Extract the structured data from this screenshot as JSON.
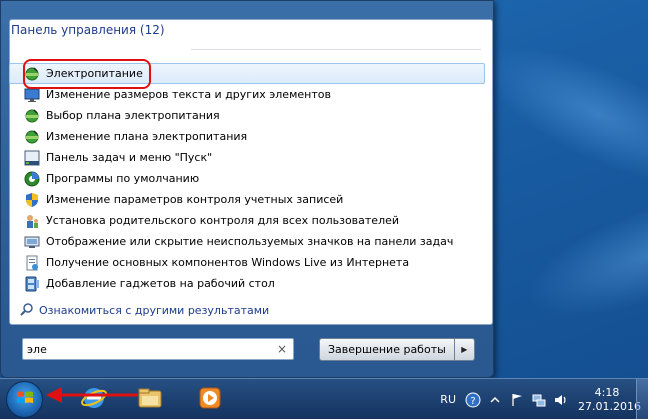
{
  "start_menu": {
    "section_header": "Панель управления (12)",
    "results": [
      {
        "label": "Электропитание",
        "icon": "power-options-icon",
        "selected": true
      },
      {
        "label": "Изменение размеров текста и других элементов",
        "icon": "display-icon"
      },
      {
        "label": "Выбор плана электропитания",
        "icon": "power-options-icon"
      },
      {
        "label": "Изменение плана электропитания",
        "icon": "power-options-icon"
      },
      {
        "label": "Панель задач и меню \"Пуск\"",
        "icon": "taskbar-icon"
      },
      {
        "label": "Программы по умолчанию",
        "icon": "default-programs-icon"
      },
      {
        "label": "Изменение параметров контроля учетных записей",
        "icon": "uac-shield-icon"
      },
      {
        "label": "Установка родительского контроля для всех пользователей",
        "icon": "parental-controls-icon"
      },
      {
        "label": "Отображение или скрытие неиспользуемых значков на панели задач",
        "icon": "notification-area-icon"
      },
      {
        "label": "Получение основных компонентов Windows Live из Интернета",
        "icon": "windows-live-icon"
      },
      {
        "label": "Добавление гаджетов на рабочий стол",
        "icon": "gadgets-icon"
      }
    ],
    "more_results": "Ознакомиться с другими результатами",
    "search": {
      "value": "эле",
      "clear_symbol": "×"
    },
    "shutdown": {
      "label": "Завершение работы",
      "arrow": "▶"
    }
  },
  "taskbar": {
    "language": "RU",
    "clock": {
      "time": "4:18",
      "date": "27.01.2016"
    },
    "pinned": [
      "internet-explorer-icon",
      "windows-explorer-icon",
      "media-player-icon"
    ]
  },
  "colors": {
    "header_text": "#1e3c8c",
    "annotation_red": "#e01010",
    "taskbar": "#14325f"
  }
}
